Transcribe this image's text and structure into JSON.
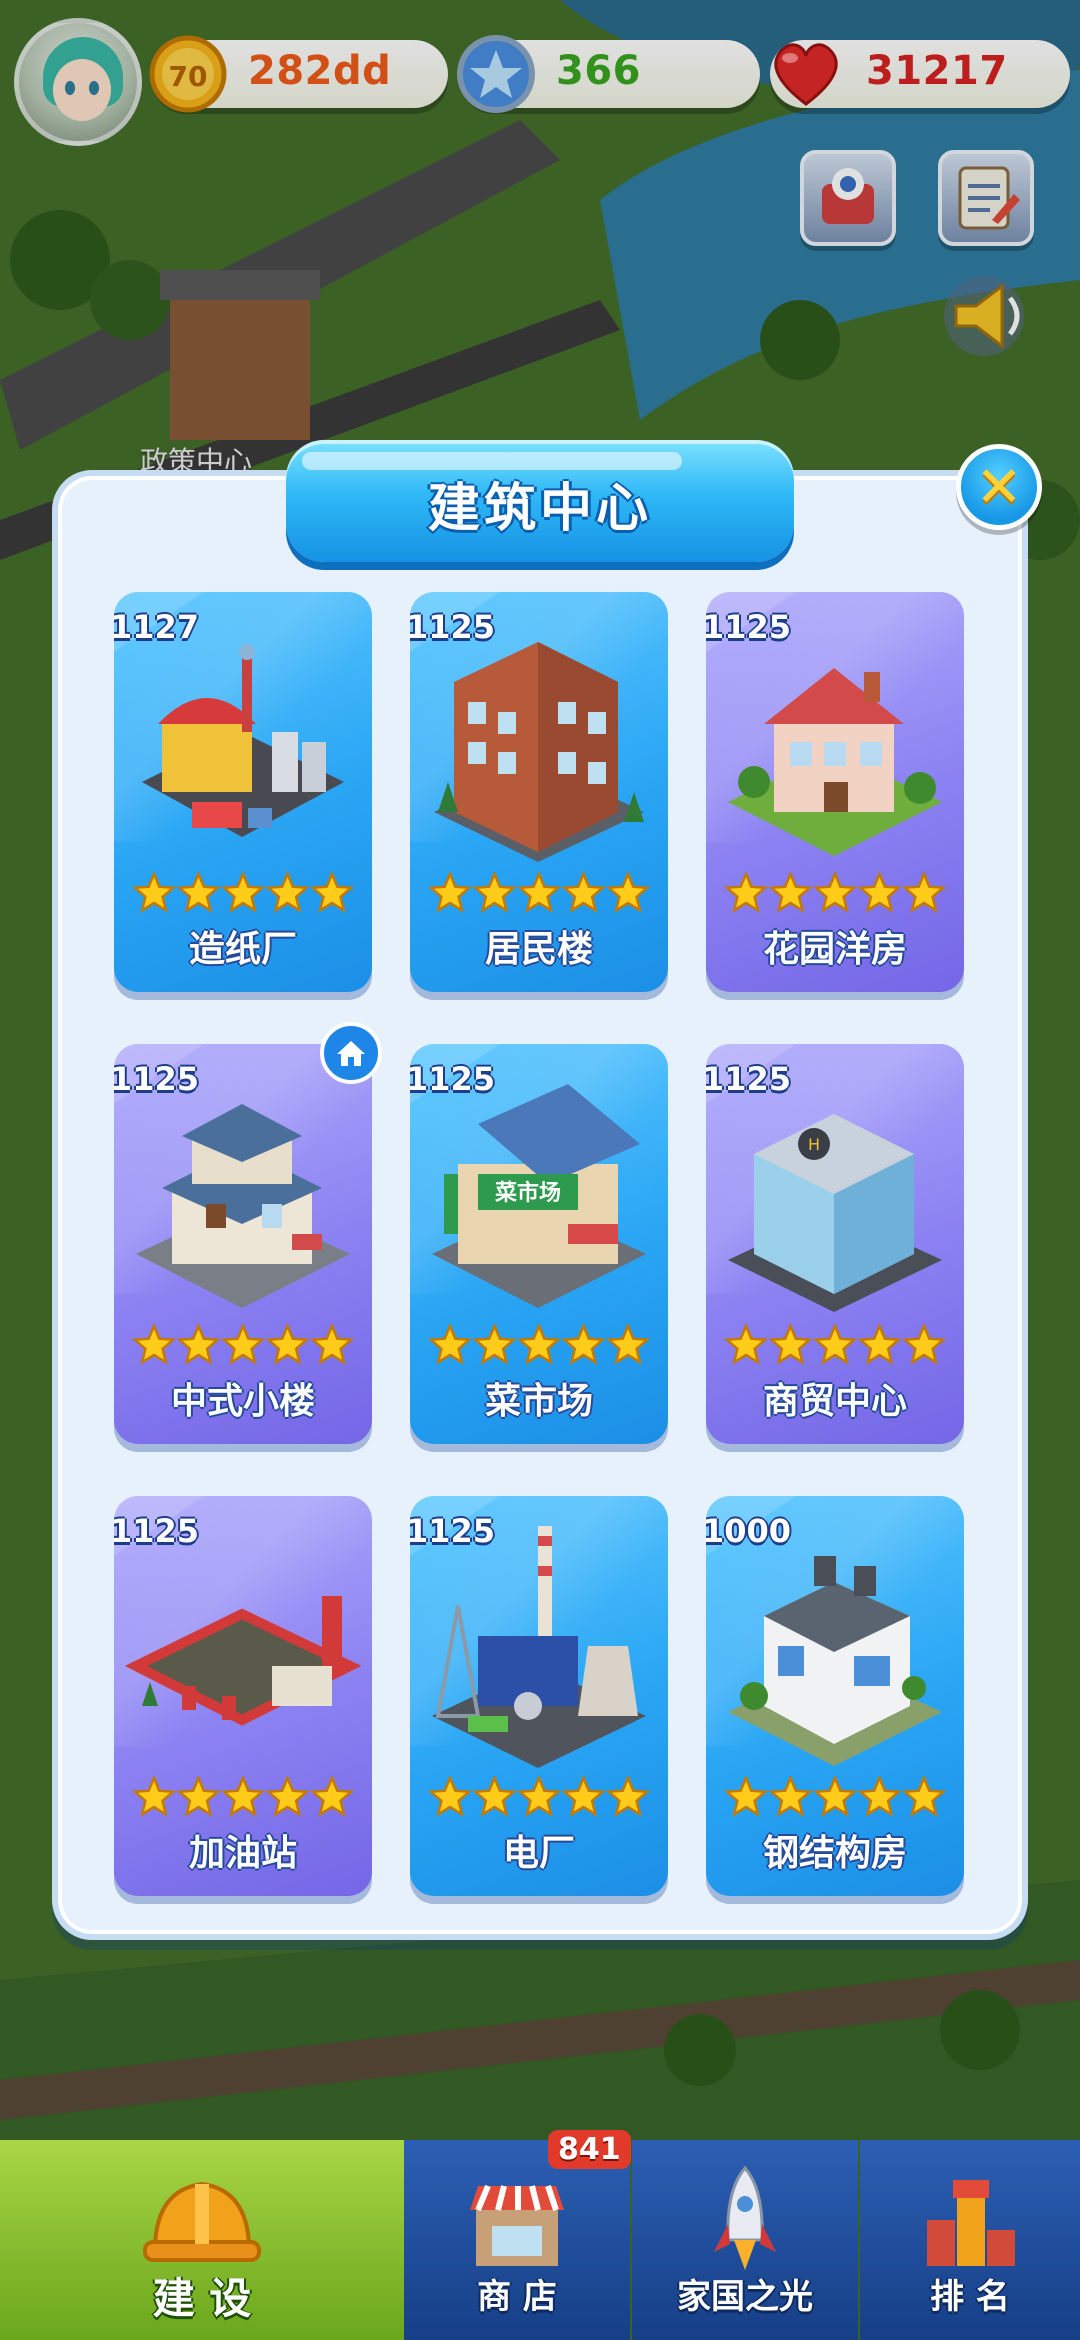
{
  "resources": {
    "coin": {
      "value": "282dd",
      "icon": "coin-icon",
      "icon_text": "70"
    },
    "star": {
      "value": "366",
      "icon": "star-icon"
    },
    "heart": {
      "value": "31217",
      "icon": "heart-icon"
    }
  },
  "map_label": "政策中心",
  "dialog": {
    "title": "建筑中心",
    "buildings": [
      {
        "number": "1127",
        "name": "造纸厂",
        "stars": 5,
        "style": "blue",
        "icon": "paper-mill-icon"
      },
      {
        "number": "1125",
        "name": "居民楼",
        "stars": 5,
        "style": "blue",
        "icon": "apartment-building-icon"
      },
      {
        "number": "1125",
        "name": "花园洋房",
        "stars": 5,
        "style": "purple",
        "icon": "garden-villa-icon"
      },
      {
        "number": "1125",
        "name": "中式小楼",
        "stars": 5,
        "style": "purple",
        "icon": "chinese-house-icon"
      },
      {
        "number": "1125",
        "name": "菜市场",
        "stars": 5,
        "style": "blue",
        "icon": "vegetable-market-icon",
        "sign": "菜市场"
      },
      {
        "number": "1125",
        "name": "商贸中心",
        "stars": 5,
        "style": "purple",
        "icon": "trade-center-icon"
      },
      {
        "number": "1125",
        "name": "加油站",
        "stars": 5,
        "style": "purple",
        "icon": "gas-station-icon"
      },
      {
        "number": "1125",
        "name": "电厂",
        "stars": 5,
        "style": "blue",
        "icon": "power-plant-icon"
      },
      {
        "number": "1000",
        "name": "钢结构房",
        "stars": 5,
        "style": "blue",
        "icon": "steel-house-icon"
      }
    ]
  },
  "nav": {
    "tabs": [
      {
        "label": "建 设",
        "icon": "hardhat-icon",
        "active": true
      },
      {
        "label": "商 店",
        "icon": "shop-icon",
        "badge": "841"
      },
      {
        "label": "家国之光",
        "icon": "rocket-icon"
      },
      {
        "label": "排 名",
        "icon": "ranking-icon"
      }
    ]
  },
  "colors": {
    "card_blue": "#2aa6f4",
    "card_purple": "#8b82f2",
    "panel": "#e6f1fc",
    "star": "#ffcc1a"
  }
}
